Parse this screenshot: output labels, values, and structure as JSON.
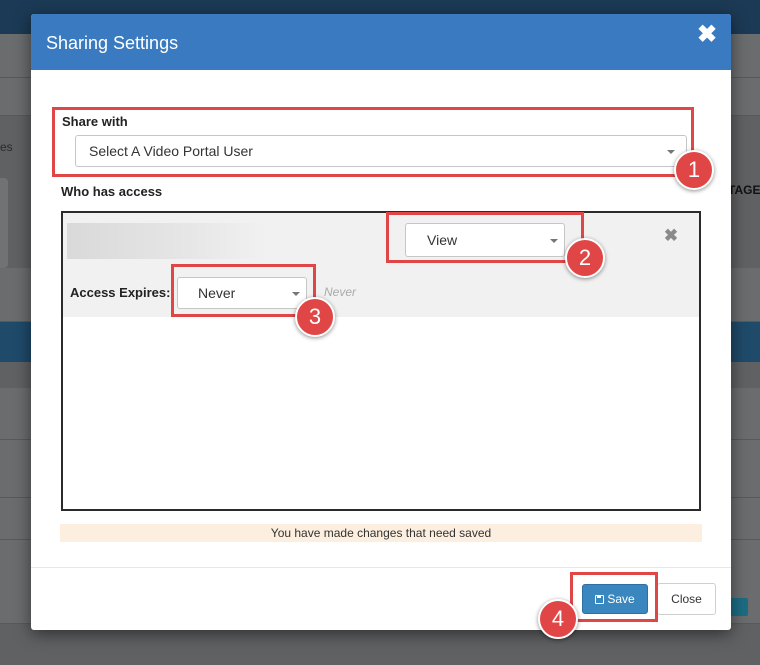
{
  "background": {
    "left_snippet": "es",
    "right_snippet": "TAGE"
  },
  "modal": {
    "title": "Sharing Settings",
    "close_glyph": "✖"
  },
  "share_with": {
    "label": "Share with",
    "select_value": "Select A Video Portal User"
  },
  "who_has_access": {
    "label": "Who has access",
    "entries": [
      {
        "permission": "View",
        "expires_label": "Access Expires:",
        "expires_value": "Never",
        "expires_hint": "Never",
        "remove_glyph": "✖"
      }
    ]
  },
  "warning_text": "You have made changes that need saved",
  "footer": {
    "save_label": "Save",
    "close_label": "Close"
  },
  "annotations": [
    "1",
    "2",
    "3",
    "4"
  ],
  "colors": {
    "header_blue": "#3a7ac0",
    "save_blue": "#3a86be",
    "annotation_red": "#e04646",
    "warning_bg": "#fcefe0"
  }
}
